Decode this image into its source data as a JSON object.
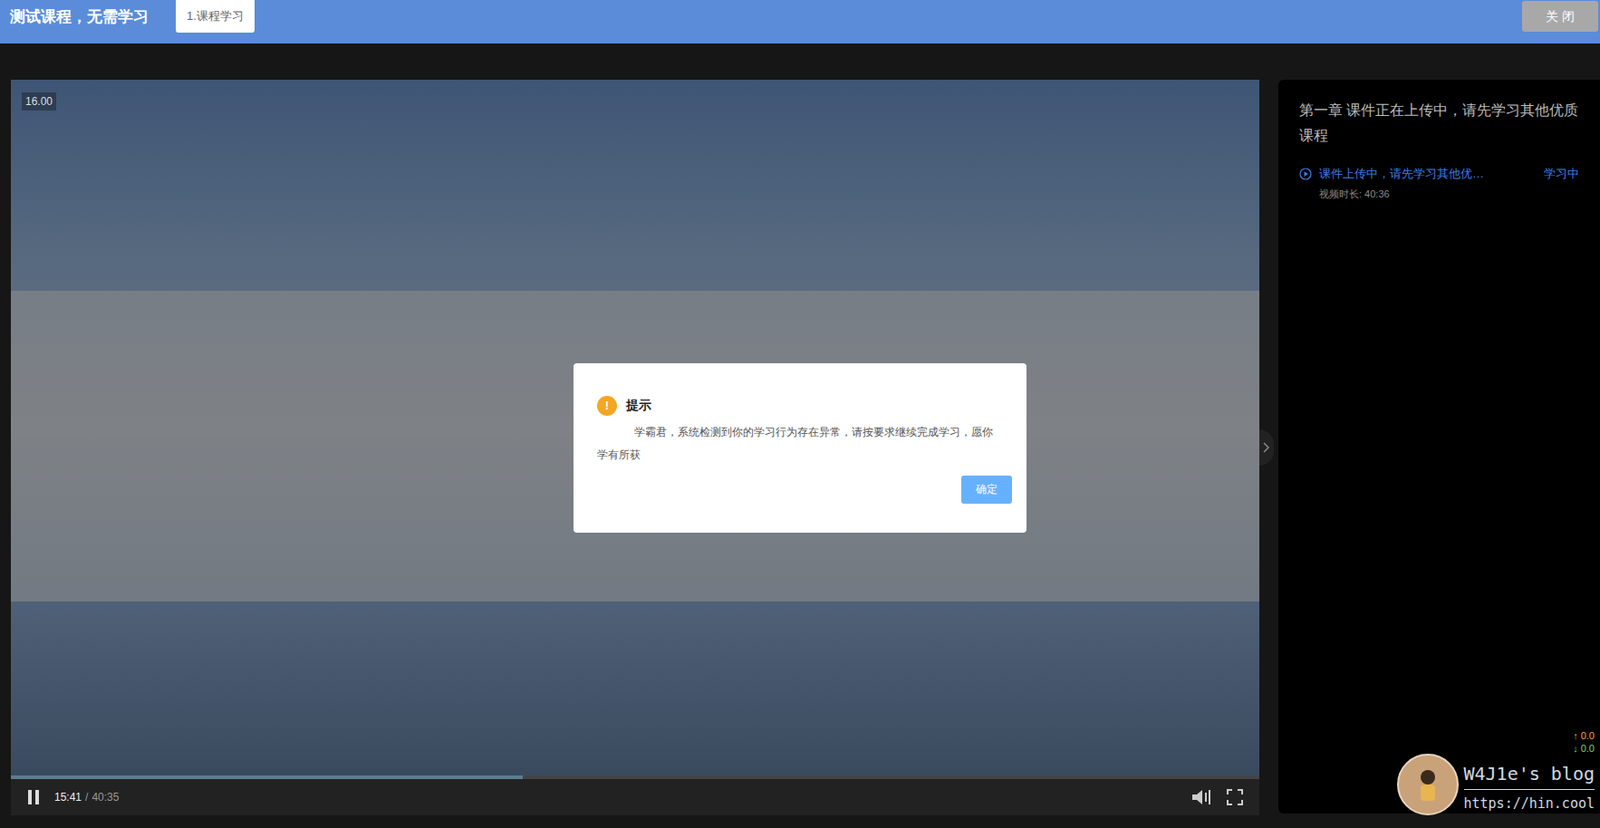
{
  "header": {
    "title": "测试课程，无需学习",
    "tabs": [
      {
        "label": "1.课程学习",
        "selected": true
      }
    ],
    "close_button": "关 闭"
  },
  "player": {
    "badge": "16.00",
    "playing": true,
    "progress": {
      "level": 0.41
    },
    "current_time": "15:41",
    "separator": "/",
    "duration": "40:35"
  },
  "dialog": {
    "icon": "!",
    "title": "提示",
    "message": "学霸君，系统检测到你的学习行为存在异常，请按要求继续完成学习，愿你学有所获",
    "button": "确定"
  },
  "sidebar": {
    "chapter": "第一章 课件正在上传中，请先学习其他优质课程",
    "lessons": [
      {
        "title": "课件上传中，请先学习其他优…",
        "status": "学习中",
        "duration": "视频时长: 40:36",
        "selected": true
      }
    ]
  },
  "overlay": {
    "upload": "↑ 0.0",
    "download": "↓ 0.0",
    "blog_name": "W4J1e's blog",
    "blog_url": "https://hin.cool"
  }
}
